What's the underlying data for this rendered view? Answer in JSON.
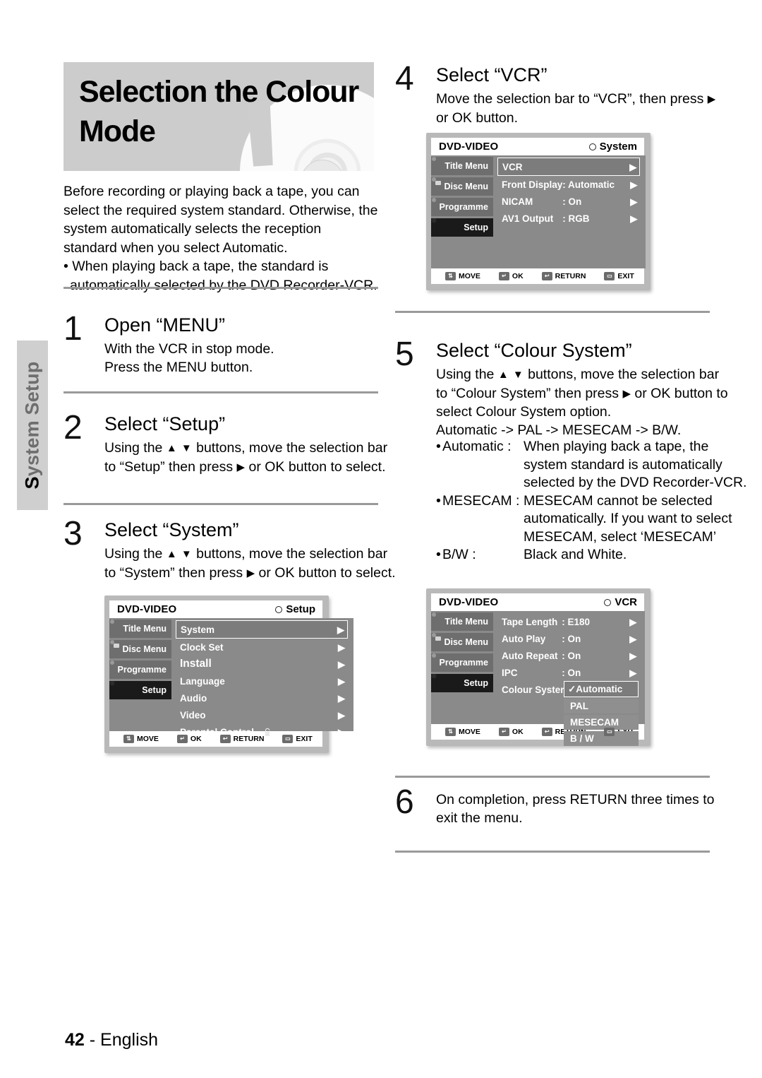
{
  "side_tab": {
    "label": "System Setup",
    "first_letter": "S",
    "rest": "ystem Setup"
  },
  "banner": {
    "title_line1": "Selection the Colour",
    "title_line2": "Mode"
  },
  "intro": {
    "paragraph": "Before recording  or playing back a tape, you can select the required system standard. Otherwise, the system automatically selects the reception standard when you select Automatic.",
    "bullet": "• When playing back a tape, the standard is automatically selected by the DVD Recorder-VCR."
  },
  "steps": {
    "s1": {
      "num": "1",
      "title": "Open “MENU”",
      "line1": "With the VCR in stop mode.",
      "line2": "Press the MENU button."
    },
    "s2": {
      "num": "2",
      "title": "Select “Setup”",
      "line1_a": "Using the",
      "line1_arrows": "▲ ▼",
      "line1_b": "buttons, move the selection bar",
      "line2_a": "to “Setup” then press",
      "line2_arrow": "▶",
      "line2_b": "or OK button to select."
    },
    "s3": {
      "num": "3",
      "title": "Select “System”",
      "line1_a": "Using the",
      "line1_arrows": "▲ ▼",
      "line1_b": "buttons, move the selection bar",
      "line2_a": "to “System” then press",
      "line2_arrow": "▶",
      "line2_b": "or OK button to select."
    },
    "s4": {
      "num": "4",
      "title": "Select “VCR”",
      "line1_a": "Move the selection bar to “VCR”, then press",
      "line1_arrow": "▶",
      "line2": "or OK button."
    },
    "s5": {
      "num": "5",
      "title": "Select “Colour System”",
      "line1_a": "Using the",
      "line1_arrows": "▲ ▼",
      "line1_b": "buttons, move the selection bar",
      "line2_a": "to “Colour System” then press",
      "line2_arrow": "▶",
      "line2_b": "or OK button to",
      "line3": "select Colour System option.",
      "line4": "Automatic -> PAL -> MESECAM -> B/W.",
      "defs": [
        {
          "term": "Automatic :",
          "desc": "When playing back a tape, the system standard is automatically selected by the DVD Recorder-VCR."
        },
        {
          "term": "MESECAM :",
          "desc": "MESECAM cannot be selected automatically. If you want to select MESECAM, select ‘MESECAM’"
        },
        {
          "term": "B/W :",
          "desc": "Black and White."
        }
      ]
    },
    "s6": {
      "num": "6",
      "line1": "On completion, press RETURN three times to",
      "line2": "exit the menu."
    }
  },
  "osd_common": {
    "brand": "DVD-VIDEO",
    "sidebar": [
      {
        "label": "Title Menu",
        "icon": "disc-icon",
        "active": false
      },
      {
        "label": "Disc Menu",
        "icon": "disc-menu-icon",
        "active": false
      },
      {
        "label": "Programme",
        "icon": "programme-icon",
        "active": false
      },
      {
        "label": "Setup",
        "icon": "gear-icon",
        "active": true
      }
    ],
    "footer": [
      {
        "label": "MOVE",
        "icon": "updown-key-icon"
      },
      {
        "label": "OK",
        "icon": "enter-key-icon"
      },
      {
        "label": "RETURN",
        "icon": "return-key-icon"
      },
      {
        "label": "EXIT",
        "icon": "exit-key-icon"
      }
    ]
  },
  "osd_setup": {
    "screen_title": "Setup",
    "rows": [
      {
        "name": "System",
        "value": "",
        "selected": true,
        "big": false,
        "lock": false
      },
      {
        "name": "Clock Set",
        "value": "",
        "selected": false,
        "big": false,
        "lock": false
      },
      {
        "name": "Install",
        "value": "",
        "selected": false,
        "big": true,
        "lock": false
      },
      {
        "name": "Language",
        "value": "",
        "selected": false,
        "big": false,
        "lock": false
      },
      {
        "name": "Audio",
        "value": "",
        "selected": false,
        "big": false,
        "lock": false
      },
      {
        "name": "Video",
        "value": "",
        "selected": false,
        "big": false,
        "lock": false
      },
      {
        "name": "Parental Control",
        "value": "",
        "selected": false,
        "big": false,
        "lock": true
      }
    ]
  },
  "osd_system": {
    "screen_title": "System",
    "rows": [
      {
        "name": "VCR",
        "value": "",
        "selected": true,
        "big": false,
        "lock": false
      },
      {
        "name": "Front Display",
        "value": ": Automatic",
        "selected": false,
        "big": false,
        "lock": false
      },
      {
        "name": "NICAM",
        "value": ": On",
        "selected": false,
        "big": false,
        "lock": false
      },
      {
        "name": "AV1 Output",
        "value": ": RGB",
        "selected": false,
        "big": false,
        "lock": false
      }
    ]
  },
  "osd_vcr": {
    "screen_title": "VCR",
    "rows": [
      {
        "name": "Tape Length",
        "value": ": E180",
        "selected": false,
        "big": false,
        "lock": false
      },
      {
        "name": "Auto Play",
        "value": ": On",
        "selected": false,
        "big": false,
        "lock": false
      },
      {
        "name": "Auto Repeat",
        "value": ": On",
        "selected": false,
        "big": false,
        "lock": false
      },
      {
        "name": "IPC",
        "value": ": On",
        "selected": false,
        "big": false,
        "lock": false
      },
      {
        "name": "Colour System",
        "value": "",
        "selected": false,
        "big": false,
        "lock": false
      }
    ],
    "dropdown": [
      {
        "label": "✓Automatic",
        "selected": true
      },
      {
        "label": "PAL",
        "selected": false
      },
      {
        "label": "MESECAM",
        "selected": false
      },
      {
        "label": "B / W",
        "selected": false
      }
    ]
  },
  "footer": {
    "page": "42",
    "sep": "-",
    "language": "English"
  }
}
